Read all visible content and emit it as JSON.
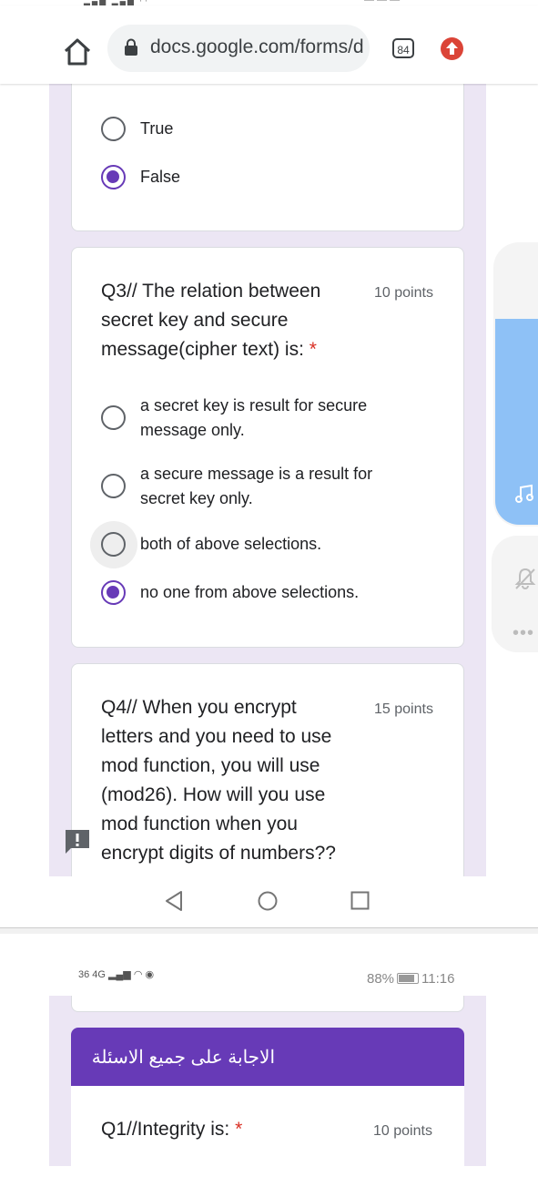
{
  "browser": {
    "url": "docs.google.com/forms/d",
    "tab_count": "84",
    "icons": [
      "home-icon",
      "lock-icon",
      "tabs-icon",
      "update-icon"
    ]
  },
  "q2_options": [
    {
      "label": "True",
      "selected": false
    },
    {
      "label": "False",
      "selected": true
    }
  ],
  "q3": {
    "title_lines": [
      "Q3// The relation between",
      "secret key and secure",
      "message(cipher text) is:"
    ],
    "required_mark": "*",
    "points": "10 points",
    "options": [
      {
        "lines": [
          "a secret key is result for secure",
          "message only."
        ],
        "selected": false
      },
      {
        "lines": [
          "a secure message is a result for",
          "secret key only."
        ],
        "selected": false
      },
      {
        "lines": [
          "both of above selections."
        ],
        "selected": false,
        "focused": true
      },
      {
        "lines": [
          "no one from above selections."
        ],
        "selected": true
      }
    ]
  },
  "q4": {
    "title_lines": [
      "Q4// When you encrypt",
      "letters and you need to use",
      "mod function, you will use",
      "(mod26). How will you use",
      "mod function when you",
      "encrypt digits of numbers??"
    ],
    "points": "15 points"
  },
  "status2": {
    "left": "36 4G",
    "battery": "88%",
    "time": "11:16"
  },
  "section_header": "الاجابة على جميع الاسئلة",
  "q1": {
    "title": "Q1//Integrity is:",
    "required_mark": "*",
    "points": "10 points"
  },
  "colors": {
    "accent": "#673ab7",
    "form_bg": "#ece6f4",
    "required": "#d93025",
    "float_blue": "#8ec1f6"
  }
}
